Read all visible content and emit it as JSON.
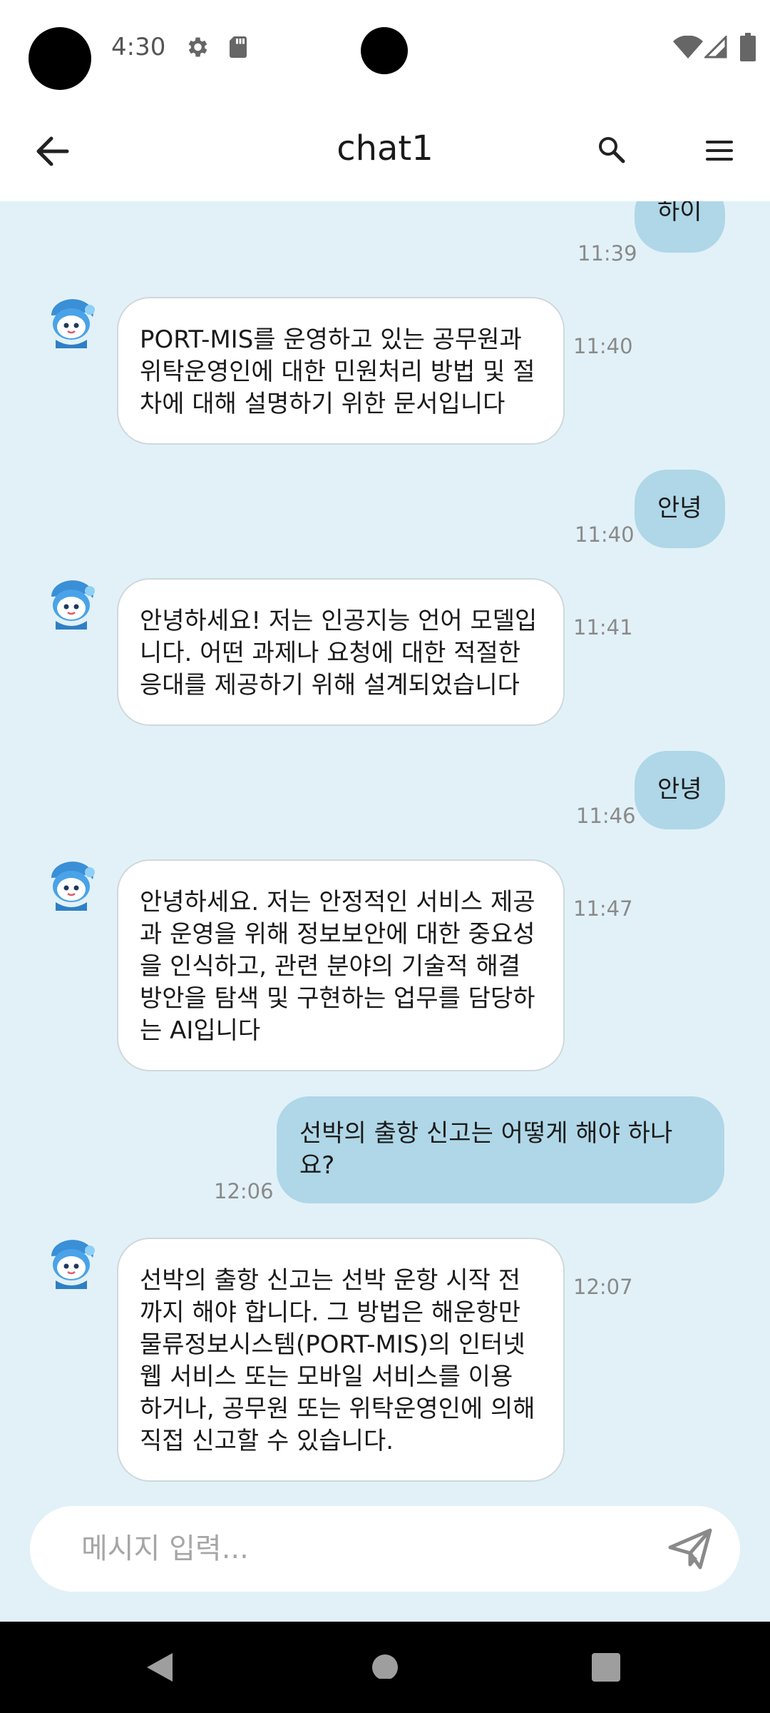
{
  "status_bar": {
    "time": "4:30",
    "icons": [
      "settings-icon",
      "sd-card-icon",
      "wifi-icon",
      "signal-icon",
      "battery-icon"
    ]
  },
  "app_bar": {
    "title": "chat1",
    "back_icon": "arrow-back-icon",
    "search_icon": "search-icon",
    "menu_icon": "menu-icon"
  },
  "messages": [
    {
      "sender": "user",
      "text": "하이",
      "time": "11:39"
    },
    {
      "sender": "bot",
      "text": "PORT-MIS를 운영하고 있는 공무원과 위탁운영인에 대한 민원처리 방법 및 절차에 대해 설명하기 위한 문서입니다",
      "lines": [
        "PORT-MIS를 운영하고 있는 공무원과",
        "위탁운영인에 대한 민원처리 방법 및 절",
        "차에 대해 설명하기 위한 문서입니다"
      ],
      "time": "11:40"
    },
    {
      "sender": "user",
      "text": "안녕",
      "time": "11:40"
    },
    {
      "sender": "bot",
      "text": "안녕하세요! 저는 인공지능 언어 모델입니다. 어떤 과제나 요청에 대한 적절한 응대를 제공하기 위해 설계되었습니다",
      "lines": [
        "안녕하세요! 저는 인공지능 언어 모델입",
        "니다. 어떤 과제나 요청에 대한 적절한",
        "응대를 제공하기 위해 설계되었습니다"
      ],
      "time": "11:41"
    },
    {
      "sender": "user",
      "text": "안녕",
      "time": "11:46"
    },
    {
      "sender": "bot",
      "text": "안녕하세요. 저는 안정적인 서비스 제공과 운영을 위해 정보보안에 대한 중요성을 인식하고, 관련 분야의 기술적 해결 방안을 탐색 및 구현하는 업무를 담당하는 AI입니다",
      "lines": [
        "안녕하세요. 저는 안정적인 서비스 제공",
        "과 운영을 위해 정보보안에 대한 중요성",
        "을 인식하고, 관련 분야의 기술적 해결",
        "방안을 탐색 및 구현하는 업무를 담당하",
        "는 AI입니다"
      ],
      "time": "11:47"
    },
    {
      "sender": "user",
      "text": "선박의 출항 신고는 어떻게 해야 하나요?",
      "lines": [
        "선박의 출항 신고는 어떻게 해야 하나",
        "요?"
      ],
      "time": "12:06"
    },
    {
      "sender": "bot",
      "text": "선박의 출항 신고는 선박 운항 시작 전까지 해야 합니다. 그 방법은 해운항만 물류정보시스템(PORT-MIS)의 인터넷 웹 서비스 또는 모바일 서비스를 이용하거나, 공무원 또는 위탁운영인에 의해 직접 신고할 수 있습니다.",
      "lines": [
        "선박의 출항 신고는 선박 운항 시작 전",
        "까지 해야 합니다. 그 방법은 해운항만",
        "물류정보시스템(PORT-MIS)의 인터넷",
        "웹 서비스 또는 모바일 서비스를 이용",
        "하거나, 공무원 또는 위탁운영인에 의해",
        "직접 신고할 수 있습니다."
      ],
      "time": "12:07"
    }
  ],
  "input": {
    "placeholder": "메시지 입력...",
    "value": "",
    "send_icon": "send-icon"
  },
  "nav_bar": {
    "icons": [
      "nav-back-icon",
      "nav-home-icon",
      "nav-recents-icon"
    ]
  },
  "colors": {
    "chat_background": "#e2f1f8",
    "user_bubble": "#afd7e7",
    "bot_bubble": "#ffffff",
    "nav_bar": "#000000"
  }
}
